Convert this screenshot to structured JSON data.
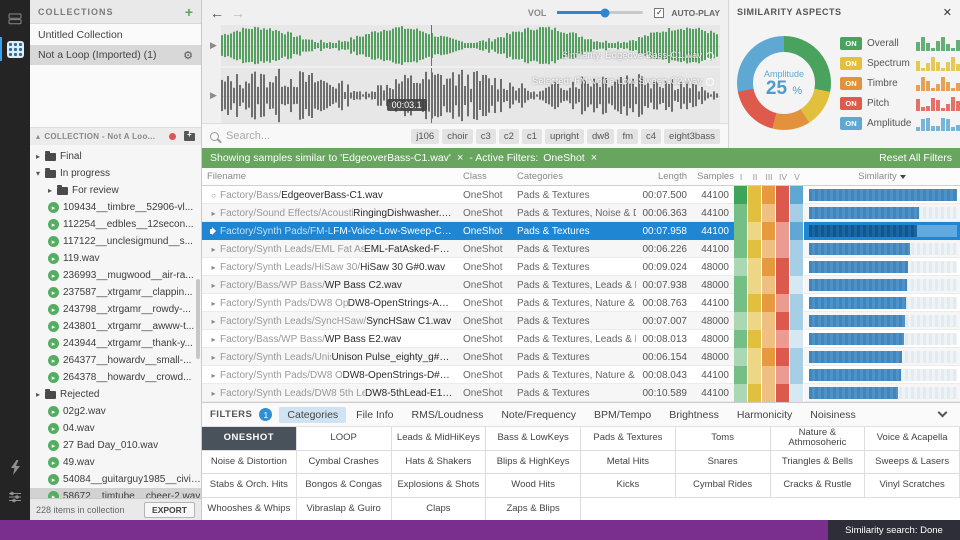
{
  "sidebar": {
    "header": {
      "title": "COLLECTIONS",
      "add": "+"
    },
    "collections": [
      {
        "label": "Untitled Collection",
        "selected": false,
        "gear": false
      },
      {
        "label": "Not a Loop (Imported) (1)",
        "selected": true,
        "gear": true
      }
    ],
    "tree_header": {
      "title": "COLLECTION - Not A Loo..."
    },
    "tree": [
      {
        "kind": "folder",
        "label": "Final",
        "depth": 0,
        "caret": "collapsed"
      },
      {
        "kind": "folder",
        "label": "In progress",
        "depth": 0,
        "caret": "expanded"
      },
      {
        "kind": "folder",
        "label": "For review",
        "depth": 1,
        "caret": "collapsed"
      },
      {
        "kind": "file",
        "label": "109434__timbre__52906-vl...",
        "depth": 1
      },
      {
        "kind": "file",
        "label": "112254__edbles__12secon...",
        "depth": 1
      },
      {
        "kind": "file",
        "label": "117122__unclesigmund__s...",
        "depth": 1
      },
      {
        "kind": "file",
        "label": "119.wav",
        "depth": 1
      },
      {
        "kind": "file",
        "label": "236993__mugwood__air-ra...",
        "depth": 1
      },
      {
        "kind": "file",
        "label": "237587__xtrgamr__clappin...",
        "depth": 1
      },
      {
        "kind": "file",
        "label": "243798__xtrgamr__rowdy-...",
        "depth": 1
      },
      {
        "kind": "file",
        "label": "243801__xtrgamr__awww-t...",
        "depth": 1
      },
      {
        "kind": "file",
        "label": "243944__xtrgamr__thank-y...",
        "depth": 1
      },
      {
        "kind": "file",
        "label": "264377__howardv__small-...",
        "depth": 1
      },
      {
        "kind": "file",
        "label": "264378__howardv__crowd...",
        "depth": 1
      },
      {
        "kind": "folder",
        "label": "Rejected",
        "depth": 0,
        "caret": "collapsed"
      },
      {
        "kind": "file",
        "label": "02g2.wav",
        "depth": 1
      },
      {
        "kind": "file",
        "label": "04.wav",
        "depth": 1
      },
      {
        "kind": "file",
        "label": "27 Bad Day_010.wav",
        "depth": 1
      },
      {
        "kind": "file",
        "label": "49.wav",
        "depth": 1
      },
      {
        "kind": "file",
        "label": "54084__guitarguy1985__civild...",
        "depth": 1
      },
      {
        "kind": "file",
        "label": "58672__timtube__cheer-2.wav",
        "depth": 1,
        "selected": true
      }
    ],
    "footer": {
      "count": "228 items in collection",
      "export": "EXPORT"
    }
  },
  "transport": {
    "vol_label": "VOL",
    "autoplay_label": "AUTO-PLAY",
    "autoplay_checked": true
  },
  "waveforms": {
    "top": {
      "overlay": "Similarity: EdgeoverBass-C1.wav",
      "color": "#55a061"
    },
    "bottom": {
      "overlay": "Selected: FM-Voice-Low-Sweep-C2.wav",
      "color": "#6e6e6e"
    },
    "playhead_time": "00:03.1"
  },
  "search": {
    "placeholder": "Search...",
    "tags": [
      "j106",
      "choir",
      "c3",
      "c2",
      "c1",
      "upright",
      "dw8",
      "fm",
      "c4",
      "eight3bass"
    ]
  },
  "banner": {
    "similar_text": "Showing samples similar to 'EdgeoverBass-C1.wav'",
    "close": "×",
    "filters_label": "- Active Filters:",
    "filter_chip": "OneShot",
    "reset": "Reset All Filters"
  },
  "table": {
    "headers": {
      "filename": "Filename",
      "class": "Class",
      "categories": "Categories",
      "length": "Length",
      "samples": "Samples",
      "aspects": [
        "I",
        "II",
        "III",
        "IV",
        "V"
      ],
      "similarity": "Similarity"
    },
    "rows": [
      {
        "icon": "circle",
        "path": "Factory/Bass/",
        "name": "EdgeoverBass-C1.wav",
        "class": "OneShot",
        "categories": "Pads & Textures",
        "length": "00:07.500",
        "samples": "44100",
        "aspects": [
          "#3da45c",
          "#e2bf3e",
          "#e6993f",
          "#dc594d",
          "#5fa8d3"
        ],
        "similarity": 1.0,
        "selected": false
      },
      {
        "icon": "play",
        "path": "Factory/Sound Effects/Acoustic/",
        "name": "RingingDishwasher.wav",
        "class": "OneShot",
        "categories": "Pads & Textures, Noise & Disto...",
        "length": "00:06.363",
        "samples": "44100",
        "aspects": [
          "#74bf85",
          "#e2bf3e",
          "#f0c083",
          "#dc594d",
          "#a6cee5"
        ],
        "similarity": 0.74,
        "selected": false
      },
      {
        "icon": "speaker",
        "path": "Factory/Synth Pads/FM-Lo...",
        "name": "FM-Voice-Low-Sweep-C2.wav",
        "class": "OneShot",
        "categories": "Pads & Textures",
        "length": "00:07.958",
        "samples": "44100",
        "aspects": [
          "#74bf85",
          "#edd685",
          "#e6993f",
          "#ec9b90",
          "#5fa8d3"
        ],
        "similarity": 0.73,
        "selected": true
      },
      {
        "icon": "play",
        "path": "Factory/Synth Leads/EML Fat Aske...",
        "name": "EML-FatAsked-F1.wav",
        "class": "OneShot",
        "categories": "Pads & Textures",
        "length": "00:06.226",
        "samples": "44100",
        "aspects": [
          "#74bf85",
          "#e2bf3e",
          "#f0c083",
          "#ec9b90",
          "#a6cee5"
        ],
        "similarity": 0.68,
        "selected": false
      },
      {
        "icon": "play",
        "path": "Factory/Synth Leads/HiSaw 30/",
        "name": "HiSaw 30 G#0.wav",
        "class": "OneShot",
        "categories": "Pads & Textures",
        "length": "00:09.024",
        "samples": "48000",
        "aspects": [
          "#abd7b4",
          "#edd685",
          "#e6993f",
          "#dc594d",
          "#a6cee5"
        ],
        "similarity": 0.67,
        "selected": false
      },
      {
        "icon": "play",
        "path": "Factory/Bass/WP Bass/",
        "name": "WP Bass C2.wav",
        "class": "OneShot",
        "categories": "Pads & Textures, Leads & Mid...",
        "length": "00:07.938",
        "samples": "48000",
        "aspects": [
          "#74bf85",
          "#edd685",
          "#f0c083",
          "#dc594d",
          "#d6e8f2"
        ],
        "similarity": 0.66,
        "selected": false
      },
      {
        "icon": "play",
        "path": "Factory/Synth Pads/DW8 Ope...",
        "name": "DW8-OpenStrings-A0.wav",
        "class": "OneShot",
        "categories": "Pads & Textures, Nature & Ath...",
        "length": "00:08.763",
        "samples": "44100",
        "aspects": [
          "#74bf85",
          "#e2bf3e",
          "#e6993f",
          "#ec9b90",
          "#a6cee5"
        ],
        "similarity": 0.655,
        "selected": false
      },
      {
        "icon": "play",
        "path": "Factory/Synth Leads/SyncHSaw/",
        "name": "SyncHSaw C1.wav",
        "class": "OneShot",
        "categories": "Pads & Textures",
        "length": "00:07.007",
        "samples": "48000",
        "aspects": [
          "#abd7b4",
          "#edd685",
          "#f0c083",
          "#dc594d",
          "#a6cee5"
        ],
        "similarity": 0.65,
        "selected": false
      },
      {
        "icon": "play",
        "path": "Factory/Bass/WP Bass/",
        "name": "WP Bass E2.wav",
        "class": "OneShot",
        "categories": "Pads & Textures, Leads & Mid...",
        "length": "00:08.013",
        "samples": "48000",
        "aspects": [
          "#74bf85",
          "#e2bf3e",
          "#f0c083",
          "#ec9b90",
          "#d6e8f2"
        ],
        "similarity": 0.64,
        "selected": false
      },
      {
        "icon": "play",
        "path": "Factory/Synth Leads/Unis...",
        "name": "Unison Pulse_eighty_g#0.wav",
        "class": "OneShot",
        "categories": "Pads & Textures",
        "length": "00:06.154",
        "samples": "48000",
        "aspects": [
          "#abd7b4",
          "#edd685",
          "#e6993f",
          "#dc594d",
          "#a6cee5"
        ],
        "similarity": 0.63,
        "selected": false
      },
      {
        "icon": "play",
        "path": "Factory/Synth Pads/DW8 Op...",
        "name": "DW8-OpenStrings-D#1.wav",
        "class": "OneShot",
        "categories": "Pads & Textures, Nature & Ath...",
        "length": "00:08.043",
        "samples": "44100",
        "aspects": [
          "#74bf85",
          "#edd685",
          "#f0c083",
          "#ec9b90",
          "#a6cee5"
        ],
        "similarity": 0.62,
        "selected": false
      },
      {
        "icon": "play",
        "path": "Factory/Synth Leads/DW8 5th Lead/",
        "name": "DW8-5thLead-E1.wav",
        "class": "OneShot",
        "categories": "Pads & Textures",
        "length": "00:10.589",
        "samples": "44100",
        "aspects": [
          "#abd7b4",
          "#e2bf3e",
          "#f0c083",
          "#dc594d",
          "#d6e8f2"
        ],
        "similarity": 0.6,
        "selected": false
      }
    ]
  },
  "similarity_panel": {
    "title": "SIMILARITY ASPECTS",
    "close": "✕",
    "center_label": "Amplitude",
    "center_value": "25",
    "center_unit": "%",
    "aspects": [
      {
        "state": "ON",
        "label": "Overall",
        "color": "#49a25e"
      },
      {
        "state": "ON",
        "label": "Spectrum",
        "color": "#e3bf3e"
      },
      {
        "state": "ON",
        "label": "Timbre",
        "color": "#e2923d"
      },
      {
        "state": "ON",
        "label": "Pitch",
        "color": "#dd5a4d"
      },
      {
        "state": "ON",
        "label": "Amplitude",
        "color": "#5fa8d3"
      }
    ],
    "donut": [
      28,
      13,
      13,
      18,
      28
    ]
  },
  "filters": {
    "title": "FILTERS",
    "badge": "1",
    "tabs": [
      {
        "label": "Categories",
        "active": true
      },
      {
        "label": "File Info",
        "active": false
      },
      {
        "label": "RMS/Loudness",
        "active": false
      },
      {
        "label": "Note/Frequency",
        "active": false
      },
      {
        "label": "BPM/Tempo",
        "active": false
      },
      {
        "label": "Brightness",
        "active": false
      },
      {
        "label": "Harmonicity",
        "active": false
      },
      {
        "label": "Noisiness",
        "active": false
      }
    ],
    "grid": [
      [
        {
          "label": "ONESHOT",
          "selected": true
        },
        {
          "label": "LOOP",
          "selected": false
        },
        {
          "label": "Leads & MidHiKeys"
        },
        {
          "label": "Bass & LowKeys"
        },
        {
          "label": "Pads & Textures"
        },
        {
          "label": "Toms"
        },
        {
          "label": "Nature & Athmosoheric"
        },
        {
          "label": "Voice & Acapella"
        }
      ],
      [
        {
          "label": "Noise & Distortion"
        },
        {
          "label": "Cymbal Crashes"
        },
        {
          "label": "Hats & Shakers"
        },
        {
          "label": "Blips & HighKeys"
        },
        {
          "label": "Metal Hits"
        },
        {
          "label": "Snares"
        },
        {
          "label": "Triangles & Bells"
        },
        {
          "label": "Sweeps & Lasers"
        }
      ],
      [
        {
          "label": "Stabs & Orch. Hits"
        },
        {
          "label": "Bongos & Congas"
        },
        {
          "label": "Explosions & Shots"
        },
        {
          "label": "Wood Hits"
        },
        {
          "label": "Kicks"
        },
        {
          "label": "Cymbal Rides"
        },
        {
          "label": "Cracks & Rustle"
        },
        {
          "label": "Vinyl Scratches"
        }
      ],
      [
        {
          "label": "Whooshes & Whips"
        },
        {
          "label": "Vibraslap & Guiro"
        },
        {
          "label": "Claps"
        },
        {
          "label": "Zaps & Blips"
        },
        null,
        null,
        null,
        null
      ]
    ]
  },
  "statusbar": {
    "right": "Similarity search: Done"
  }
}
